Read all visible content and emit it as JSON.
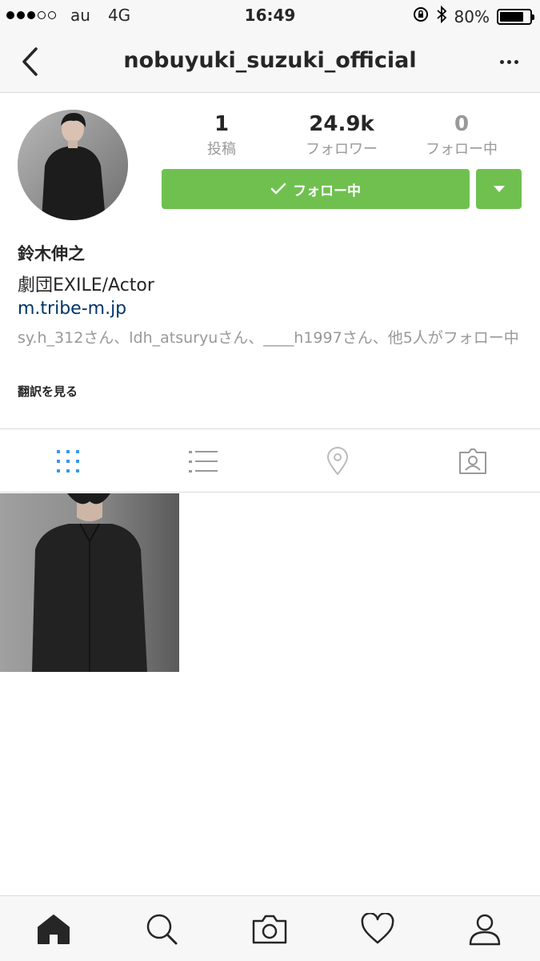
{
  "status_bar": {
    "carrier": "au",
    "network": "4G",
    "time": "16:49",
    "battery": "80%",
    "battery_level": 0.8
  },
  "header": {
    "title": "nobuyuki_suzuki_official"
  },
  "profile": {
    "stats": [
      {
        "value": "1",
        "label": "投稿"
      },
      {
        "value": "24.9k",
        "label": "フォロワー"
      },
      {
        "value": "0",
        "label": "フォロー中"
      }
    ],
    "follow_button_label": "フォロー中",
    "name": "鈴木伸之",
    "bio": "劇団EXILE/Actor",
    "link": "m.tribe-m.jp",
    "followed_by": "sy.h_312さん、ldh_atsuryuさん、____h1997さん、他5人がフォロー中",
    "translate_label": "翻訳を見る"
  },
  "colors": {
    "follow_green": "#70c050",
    "tab_active_blue": "#3897f0",
    "link_blue": "#003569",
    "muted_gray": "#999999"
  },
  "tabs": [
    {
      "icon": "grid-icon",
      "active": true
    },
    {
      "icon": "list-icon",
      "active": false
    },
    {
      "icon": "location-pin-icon",
      "active": false
    },
    {
      "icon": "tagged-photos-icon",
      "active": false
    }
  ],
  "bottom_nav": [
    {
      "icon": "home-icon",
      "active": true
    },
    {
      "icon": "search-icon",
      "active": false
    },
    {
      "icon": "camera-icon",
      "active": false
    },
    {
      "icon": "heart-icon",
      "active": false
    },
    {
      "icon": "profile-icon",
      "active": false
    }
  ]
}
